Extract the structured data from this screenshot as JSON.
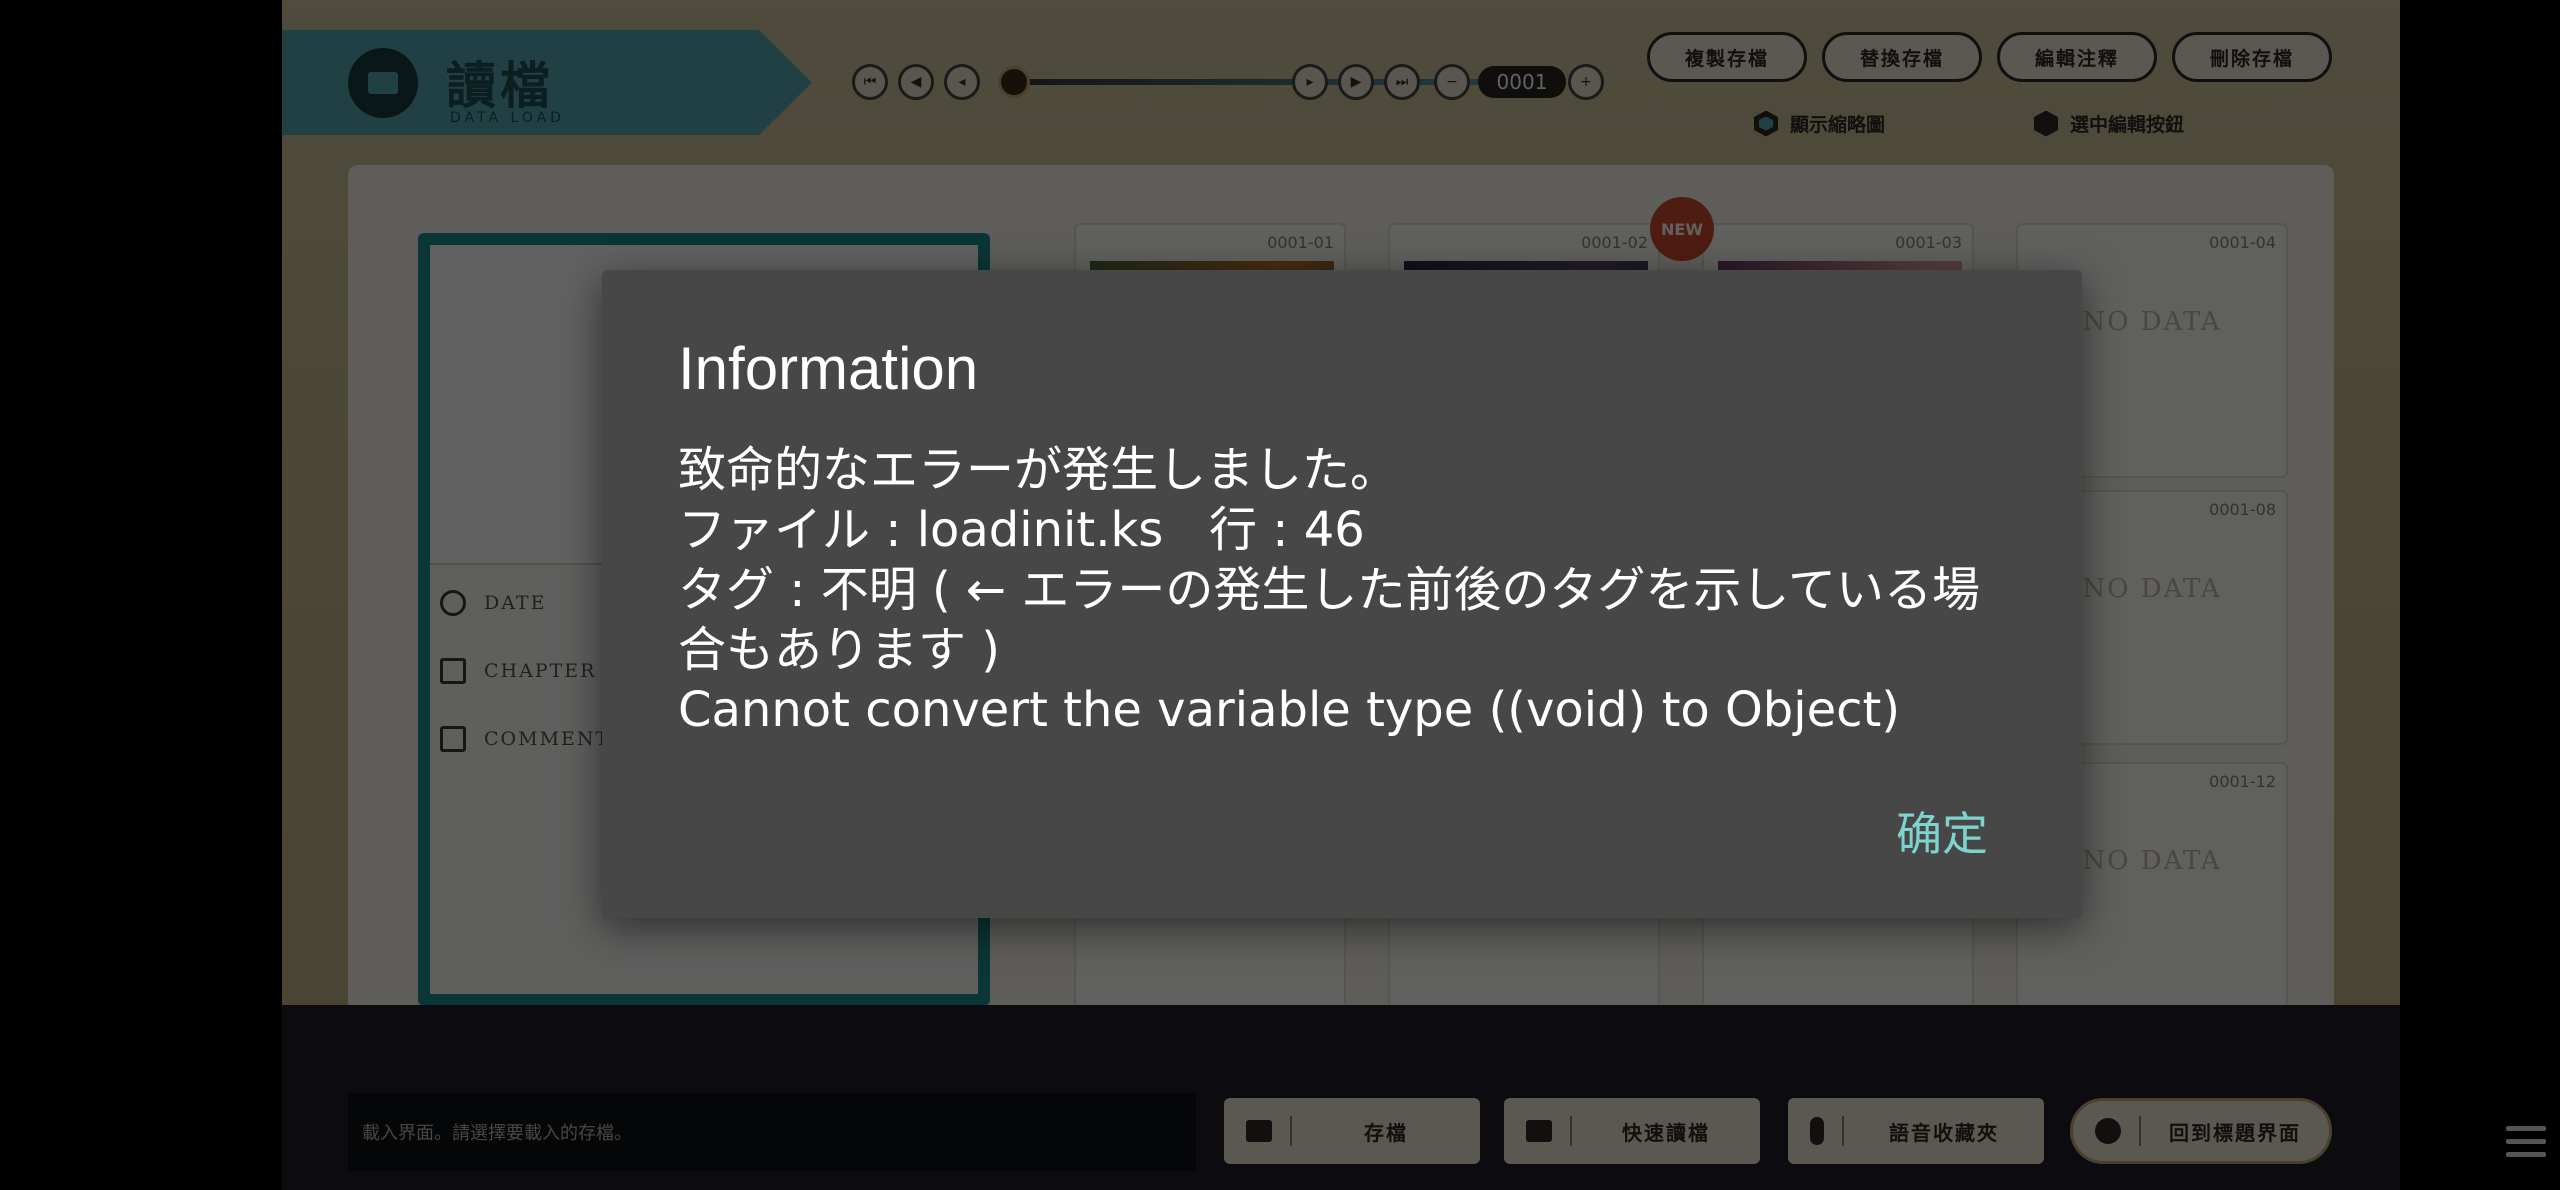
{
  "header": {
    "title": "讀檔",
    "subtitle": "DATA LOAD"
  },
  "pager": {
    "page": "0001"
  },
  "top_buttons": [
    "複製存檔",
    "替換存檔",
    "編輯注釋",
    "刪除存檔"
  ],
  "options": {
    "show_thumbnails": "顯示縮略圖",
    "edit_buttons": "選中編輯按鈕"
  },
  "info": {
    "date": "DATE",
    "chapter": "CHAPTER",
    "comment": "COMMENT"
  },
  "slots": {
    "s1": "0001-01",
    "s2": "0001-02",
    "s3": "0001-03",
    "s4": "0001-04",
    "s8": "0001-08",
    "s12": "0001-12",
    "new_badge": "NEW",
    "nodata": "NO DATA"
  },
  "status_text": "載入界面。請選擇要載入的存檔。",
  "bottom_buttons": {
    "save": "存檔",
    "quick_load": "快速讀檔",
    "voice": "語音收藏夾",
    "title": "回到標題界面"
  },
  "dialog": {
    "title": "Information",
    "line1": "致命的なエラーが発生しました。",
    "line2": "ファイル : loadinit.ks   行 : 46",
    "line3": "タグ : 不明 ( ← エラーの発生した前後のタグを示している場合もあります )",
    "line4": "Cannot convert the variable type ((void) to Object)",
    "ok": "确定"
  },
  "colors": {
    "accent": "#58a9b2",
    "frame": "#1b8f8b",
    "dialog_bg": "#474747",
    "ok_text": "#7fd3cf"
  }
}
